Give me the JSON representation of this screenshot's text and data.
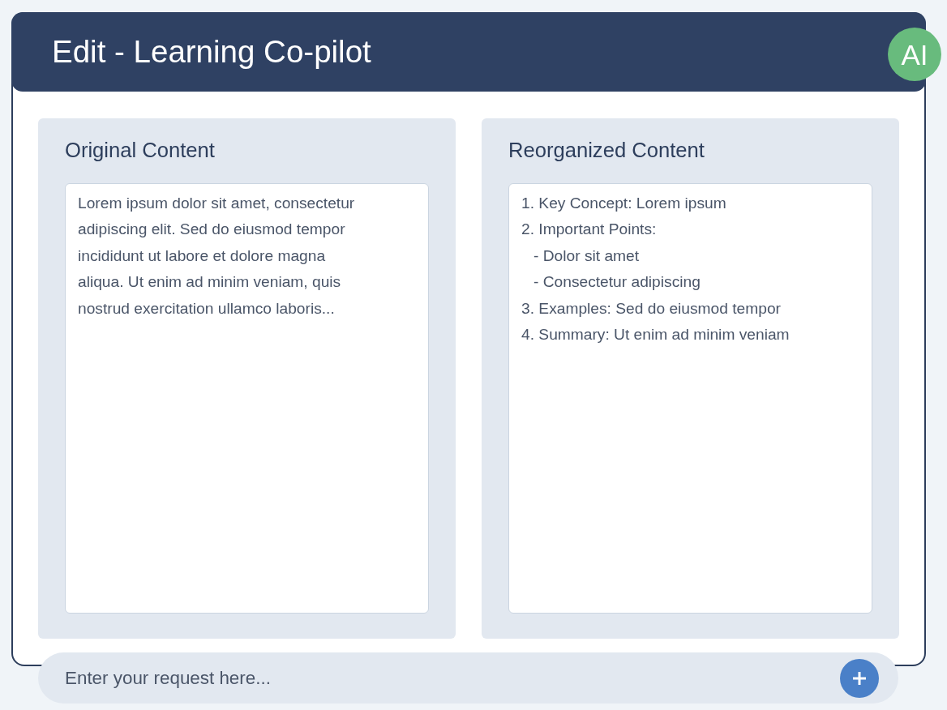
{
  "header": {
    "title": "Edit - Learning Co-pilot",
    "badge": "AI"
  },
  "panels": [
    {
      "kind": "paragraph",
      "title": "Original Content",
      "text": "Lorem ipsum dolor sit amet, consectetur adipiscing elit. Sed do eiusmod tempor incididunt ut labore et dolore magna aliqua. Ut enim ad minim veniam, quis nostrud exercitation ullamco laboris..."
    },
    {
      "kind": "outline",
      "title": "Reorganized Content",
      "items": [
        {
          "text": "1. Key Concept: Lorem ipsum"
        },
        {
          "text": "2. Important Points:",
          "children": [
            {
              "text": "- Dolor sit amet"
            },
            {
              "text": "- Consectetur adipiscing"
            }
          ]
        },
        {
          "text": "3. Examples: Sed do eiusmod tempor"
        },
        {
          "text": "4. Summary: Ut enim ad minim veniam"
        }
      ]
    }
  ],
  "request_bar": {
    "placeholder": "Enter your request here..."
  }
}
